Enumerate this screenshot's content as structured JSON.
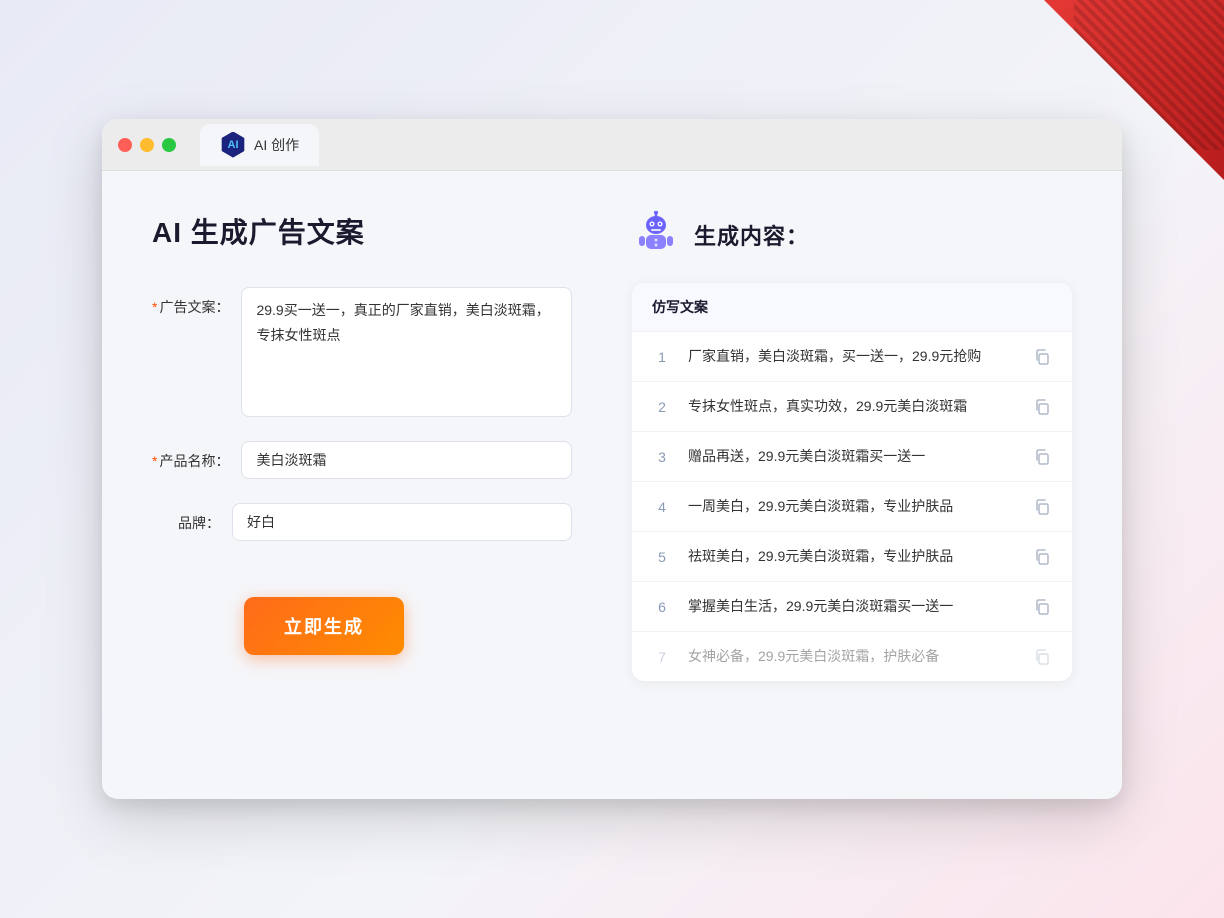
{
  "window": {
    "tab_label": "AI 创作",
    "traffic_lights": [
      "red",
      "yellow",
      "green"
    ]
  },
  "page": {
    "title": "AI 生成广告文案"
  },
  "form": {
    "ad_copy_label": "广告文案：",
    "ad_copy_required": "*",
    "ad_copy_value": "29.9买一送一，真正的厂家直销，美白淡斑霜，专抹女性斑点",
    "product_name_label": "产品名称：",
    "product_name_required": "*",
    "product_name_value": "美白淡斑霜",
    "brand_label": "品牌：",
    "brand_value": "好白",
    "generate_button": "立即生成"
  },
  "results": {
    "header_title": "生成内容：",
    "table_column": "仿写文案",
    "items": [
      {
        "num": "1",
        "text": "厂家直销，美白淡斑霜，买一送一，29.9元抢购",
        "dimmed": false
      },
      {
        "num": "2",
        "text": "专抹女性斑点，真实功效，29.9元美白淡斑霜",
        "dimmed": false
      },
      {
        "num": "3",
        "text": "赠品再送，29.9元美白淡斑霜买一送一",
        "dimmed": false
      },
      {
        "num": "4",
        "text": "一周美白，29.9元美白淡斑霜，专业护肤品",
        "dimmed": false
      },
      {
        "num": "5",
        "text": "祛斑美白，29.9元美白淡斑霜，专业护肤品",
        "dimmed": false
      },
      {
        "num": "6",
        "text": "掌握美白生活，29.9元美白淡斑霜买一送一",
        "dimmed": false
      },
      {
        "num": "7",
        "text": "女神必备，29.9元美白淡斑霜，护肤必备",
        "dimmed": true
      }
    ]
  }
}
